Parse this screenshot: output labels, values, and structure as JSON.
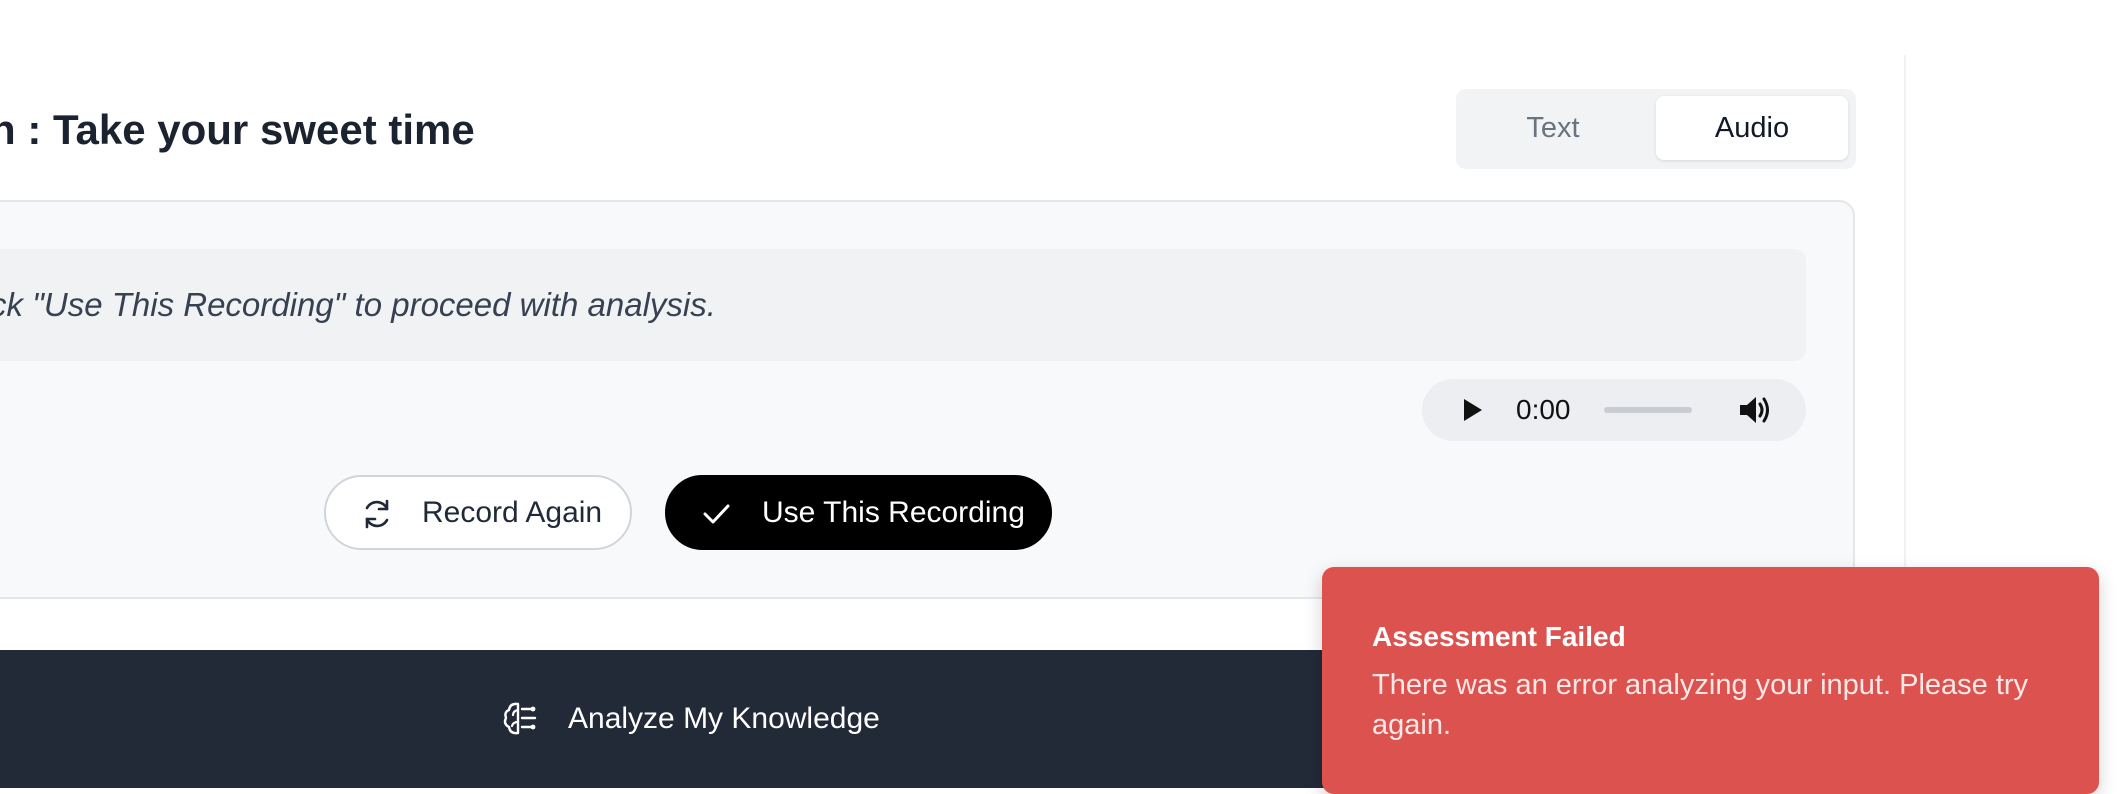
{
  "header": {
    "title": "n : Take your sweet time"
  },
  "mode_toggle": {
    "tabs": [
      {
        "label": "Text",
        "selected": false
      },
      {
        "label": "Audio",
        "selected": true
      }
    ]
  },
  "recording": {
    "instruction": "ck \"Use This Recording\" to proceed with analysis.",
    "player": {
      "time": "0:00",
      "progress": 0
    },
    "record_again_label": "Record Again",
    "use_recording_label": "Use This Recording"
  },
  "footer": {
    "analyze_label": "Analyze My Knowledge"
  },
  "toast": {
    "title": "Assessment Failed",
    "message": "There was an error analyzing your input. Please try again.",
    "color": "#dc524e"
  },
  "icons": {
    "refresh": "refresh-icon",
    "check": "check-icon",
    "play": "play-icon",
    "volume": "volume-icon",
    "brain": "brain-icon"
  },
  "colors": {
    "primary_button": "#000000",
    "footer_bar": "#222a38",
    "error": "#dc524e"
  }
}
